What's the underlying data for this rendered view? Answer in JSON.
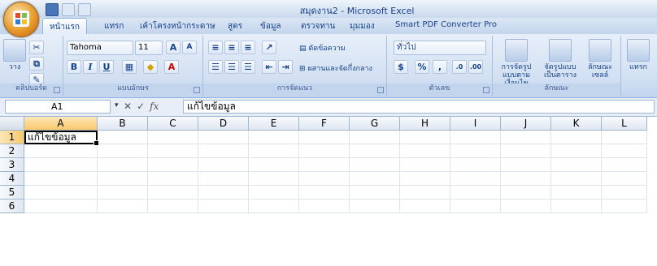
{
  "window": {
    "title": "สมุดงาน2 - Microsoft Excel"
  },
  "tabs": [
    "หน้าแรก",
    "แทรก",
    "เค้าโครงหน้ากระดาษ",
    "สูตร",
    "ข้อมูล",
    "ตรวจทาน",
    "มุมมอง",
    "Smart PDF Converter Pro"
  ],
  "ribbon": {
    "clipboard": {
      "label": "คลิปบอร์ด",
      "paste_label": "วาง"
    },
    "font": {
      "label": "แบบอักษร",
      "font_name": "Tahoma",
      "font_size": "11",
      "grow_label": "A",
      "shrink_label": "A",
      "bold": "B",
      "italic": "I",
      "underline": "U"
    },
    "alignment": {
      "label": "การจัดแนว",
      "wrap_text": "ตัดข้อความ",
      "merge_center": "ผสานและจัดกึ่งกลาง"
    },
    "number": {
      "label": "ตัวเลข",
      "format": "ทั่วไป",
      "percent": "%",
      "comma": ","
    },
    "styles": {
      "label": "ลักษณะ",
      "conditional": "การจัดรูปแบบตามเงื่อนไข",
      "as_table": "จัดรูปแบบเป็นตาราง",
      "cell_styles": "ลักษณะเซลล์"
    },
    "cells": {
      "insert": "แทรก"
    }
  },
  "formula_bar": {
    "name_box": "A1",
    "content": "แก้ไขข้อมูล",
    "fx": "fx"
  },
  "grid": {
    "columns": [
      "A",
      "B",
      "C",
      "D",
      "E",
      "F",
      "G",
      "H",
      "I",
      "J",
      "K",
      "L"
    ],
    "rows": [
      "1",
      "2",
      "3",
      "4",
      "5",
      "6"
    ],
    "active_cell": "A1",
    "cells": {
      "A1": "แก้ไขข้อมูล"
    }
  }
}
